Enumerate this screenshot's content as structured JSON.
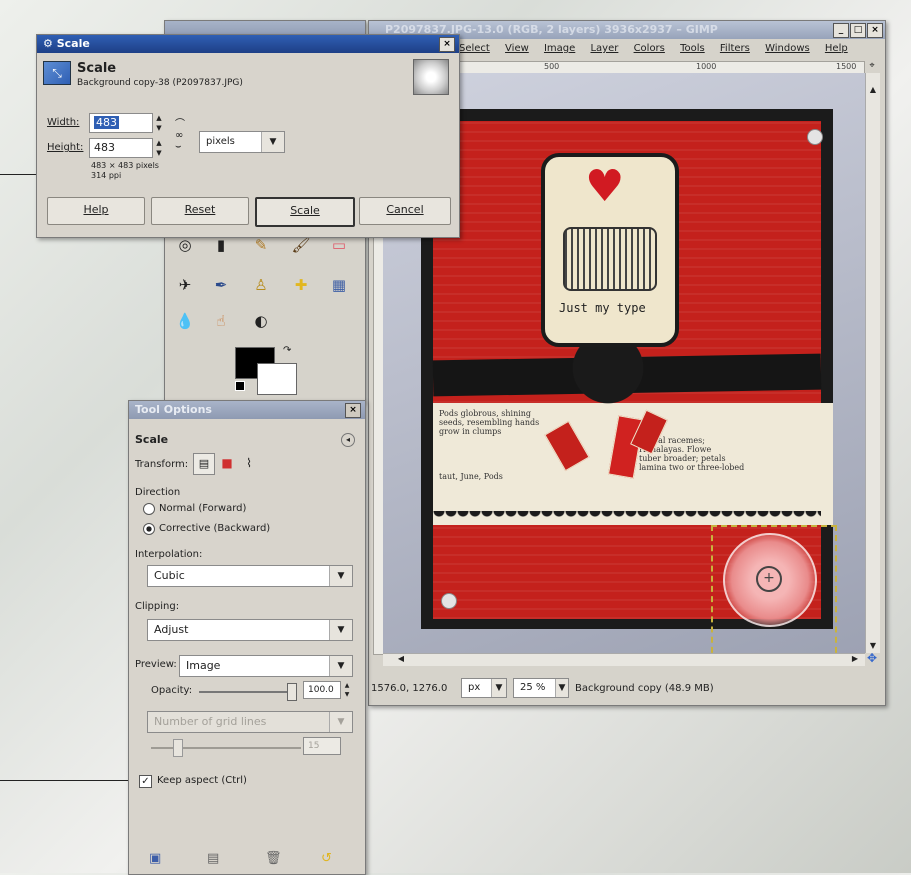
{
  "scale_dialog": {
    "title": "Scale",
    "header_title": "Scale",
    "header_subtitle": "Background copy-38 (P2097837.JPG)",
    "width_label": "Width:",
    "width_value": "483",
    "height_label": "Height:",
    "height_value": "483",
    "unit_value": "pixels",
    "size_info": "483 × 483 pixels",
    "ppi_info": "314 ppi",
    "buttons": {
      "help": "Help",
      "reset": "Reset",
      "scale": "Scale",
      "cancel": "Cancel"
    }
  },
  "image_window": {
    "title": "P2097837.JPG-13.0 (RGB, 2 layers) 3936x2937 – GIMP",
    "menu": [
      "Select",
      "View",
      "Image",
      "Layer",
      "Colors",
      "Tools",
      "Filters",
      "Windows",
      "Help"
    ],
    "ruler_marks": [
      "500",
      "1000",
      "1500"
    ],
    "status": {
      "coords": "1576.0, 1276.0",
      "unit": "px",
      "zoom": "25 %",
      "layer_info": "Background copy (48.9 MB)"
    }
  },
  "card": {
    "tag_text": "Just my type",
    "page_text": [
      "Pods globrous, shining",
      "seeds, resembling hands",
      "grow in clumps",
      "lateral racemes;",
      "Himalayas. Flowe",
      "tuber broader; petals",
      "lamina two or three-lobed",
      "taut, June, Pods"
    ]
  },
  "tool_options": {
    "title": "Tool Options",
    "section_title": "Scale",
    "transform_label": "Transform:",
    "direction_label": "Direction",
    "direction_options": [
      "Normal (Forward)",
      "Corrective (Backward)"
    ],
    "interpolation_label": "Interpolation:",
    "interpolation_value": "Cubic",
    "clipping_label": "Clipping:",
    "clipping_value": "Adjust",
    "preview_label": "Preview:",
    "preview_value": "Image",
    "opacity_label": "Opacity:",
    "opacity_value": "100.0",
    "guides_value": "Number of grid lines",
    "guides_num": "15",
    "keep_aspect_label": "Keep aspect (Ctrl)"
  },
  "colors": {
    "title_active": "#1e3f86",
    "card_red": "#c4211c",
    "card_black": "#1a1a1a",
    "tag_cream": "#efe6cc"
  }
}
